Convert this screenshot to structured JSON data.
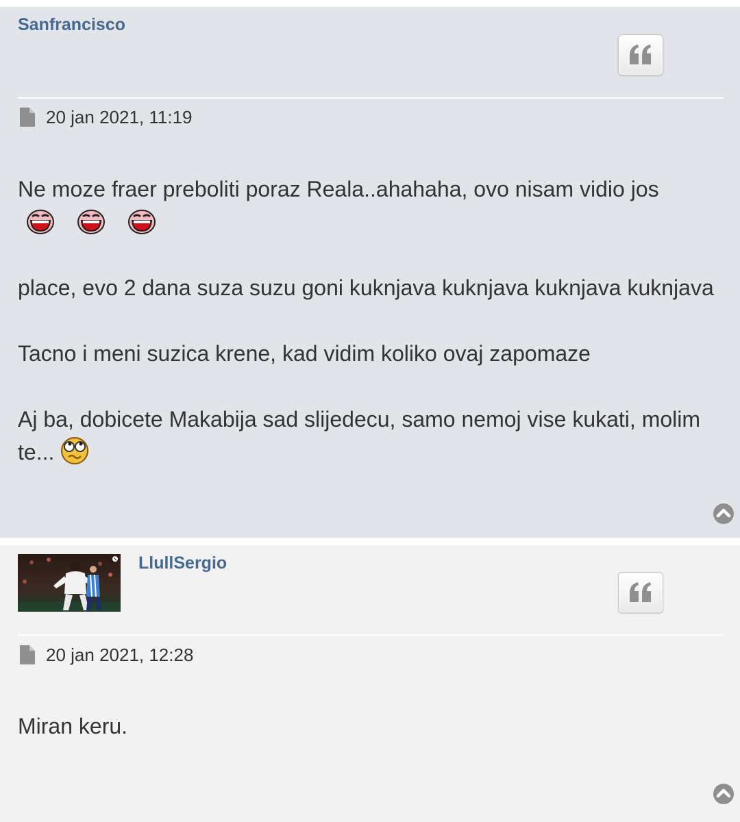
{
  "posts": [
    {
      "author": "Sanfrancisco",
      "date": "20 jan 2021, 11:19",
      "lines": [
        "Ne moze fraer preboliti poraz Reala..ahahaha, ovo nisam vidio jos",
        "place, evo 2 dana suza suzu goni kuknjava kuknjava kuknjava kuknjava",
        "Tacno i meni suzica krene, kad vidim koliko ovaj zapomaze",
        "Aj ba, dobicete Makabija sad slijedecu, samo nemoj vise kukati, molim te..."
      ],
      "smilies": [
        "laughing-smiley-icon",
        "laughing-smiley-icon",
        "laughing-smiley-icon",
        "rolling-eyes-smiley-icon"
      ]
    },
    {
      "author": "LlullSergio",
      "date": "20 jan 2021, 12:28",
      "lines": [
        "Miran keru."
      ],
      "avatar": "football-player-avatar"
    }
  ],
  "icons": {
    "quote": "quote-icon",
    "file": "file-icon",
    "top": "chevron-up-circle-icon"
  },
  "colors": {
    "author": "#47698f",
    "post1_bg": "#e1e4e8",
    "post2_bg": "#f2f2f2",
    "text": "#333333"
  }
}
